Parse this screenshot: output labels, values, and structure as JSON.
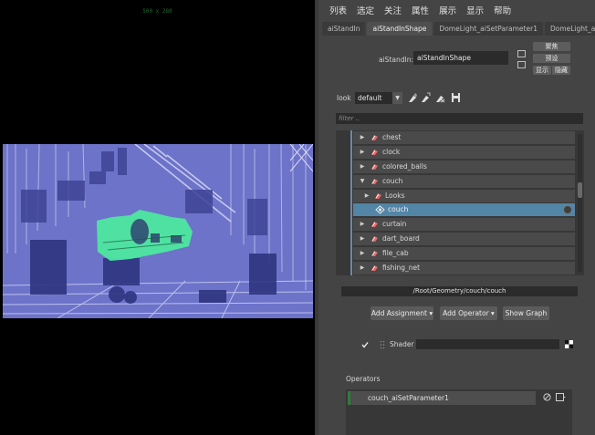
{
  "viewport": {
    "resolution_label": "500 x 280"
  },
  "menu": {
    "items": [
      "列表",
      "选定",
      "关注",
      "属性",
      "展示",
      "显示",
      "帮助"
    ]
  },
  "tabs": [
    {
      "label": "aiStandIn",
      "active": false
    },
    {
      "label": "aiStandInShape",
      "active": true
    },
    {
      "label": "DomeLight_aiSetParameter1",
      "active": false
    },
    {
      "label": "DomeLight_aiS",
      "active": false
    }
  ],
  "attribute": {
    "label": "aiStandIn:",
    "value": "aiStandInShape"
  },
  "panel_buttons": {
    "focus": "聚焦",
    "preset": "预设",
    "show": "显示",
    "hide": "隐藏"
  },
  "look": {
    "label": "look",
    "selected": "default",
    "tool_icons": [
      "assign-shader-icon",
      "edit-shader-icon",
      "remove-shader-icon",
      "save-icon"
    ]
  },
  "filter": {
    "placeholder": "filter .."
  },
  "tree": {
    "items": [
      {
        "label": "chest",
        "expanded": false,
        "level": 0,
        "selected": false
      },
      {
        "label": "clock",
        "expanded": false,
        "level": 0,
        "selected": false
      },
      {
        "label": "colored_balls",
        "expanded": false,
        "level": 0,
        "selected": false
      },
      {
        "label": "couch",
        "expanded": true,
        "level": 0,
        "selected": false
      },
      {
        "label": "Looks",
        "expanded": false,
        "level": 1,
        "selected": false
      },
      {
        "label": "couch",
        "expanded": false,
        "level": 2,
        "selected": true
      },
      {
        "label": "curtain",
        "expanded": false,
        "level": 0,
        "selected": false
      },
      {
        "label": "dart_board",
        "expanded": false,
        "level": 0,
        "selected": false
      },
      {
        "label": "file_cab",
        "expanded": false,
        "level": 0,
        "selected": false
      },
      {
        "label": "fishing_net",
        "expanded": false,
        "level": 0,
        "selected": false
      }
    ]
  },
  "selection_path": "/Root/Geometry/couch/couch",
  "actions": {
    "add_assignment": "Add Assignment",
    "add_operator": "Add Operator",
    "show_graph": "Show Graph"
  },
  "shader": {
    "label": "Shader",
    "checked": true,
    "value": ""
  },
  "operators": {
    "label": "Operators",
    "items": [
      {
        "label": "couch_aiSetParameter1",
        "color": "#2e7d3a"
      }
    ]
  },
  "colors": {
    "render_base": "#6d73c9",
    "highlight": "#4ee7a0",
    "selection": "#5285a6"
  }
}
